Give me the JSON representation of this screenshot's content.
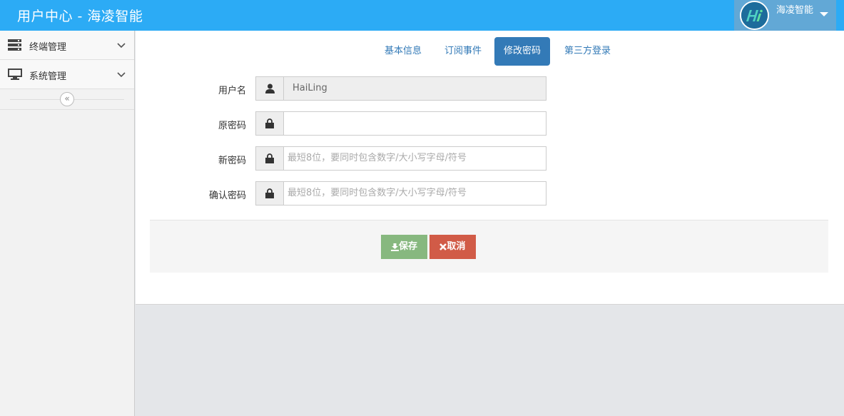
{
  "header": {
    "app_title": "用户中心 - 海凌智能",
    "user_name": "海凌智能"
  },
  "sidebar": {
    "items": [
      {
        "label": "终端管理",
        "icon": "server-icon"
      },
      {
        "label": "系统管理",
        "icon": "monitor-icon"
      }
    ],
    "collapse_glyph": "«"
  },
  "tabs": [
    {
      "label": "基本信息",
      "active": false
    },
    {
      "label": "订阅事件",
      "active": false
    },
    {
      "label": "修改密码",
      "active": true
    },
    {
      "label": "第三方登录",
      "active": false
    }
  ],
  "form": {
    "username": {
      "label": "用户名",
      "value": "HaiLing",
      "icon": "user-icon"
    },
    "old_password": {
      "label": "原密码",
      "value": "",
      "placeholder": "",
      "icon": "lock-icon"
    },
    "new_password": {
      "label": "新密码",
      "value": "",
      "placeholder": "最短8位，要同时包含数字/大小写字母/符号",
      "icon": "lock-icon"
    },
    "confirm_password": {
      "label": "确认密码",
      "value": "",
      "placeholder": "最短8位，要同时包含数字/大小写字母/符号",
      "icon": "lock-icon"
    }
  },
  "actions": {
    "save_label": "保存",
    "cancel_label": "取消"
  },
  "colors": {
    "topbar": "#2cabf5",
    "tab_active": "#337ab7",
    "save": "#87b87f",
    "cancel": "#d15b47"
  }
}
